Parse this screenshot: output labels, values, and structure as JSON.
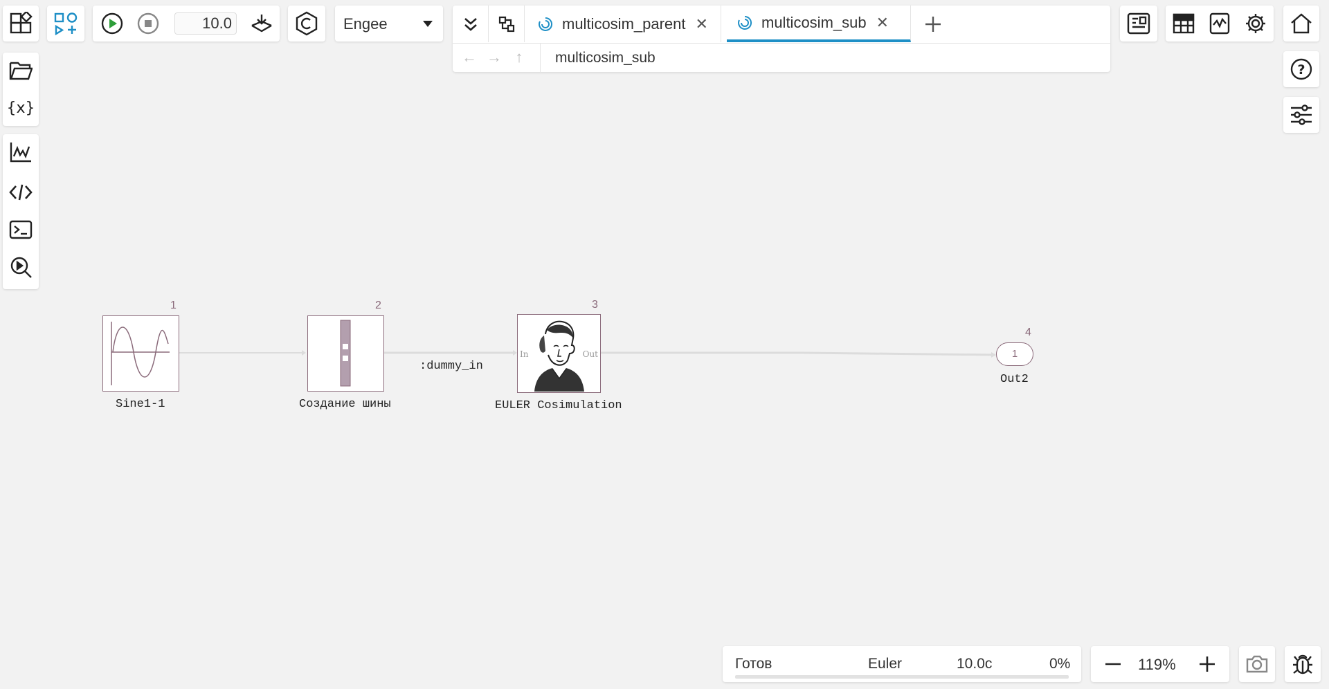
{
  "toolbar": {
    "sim_time": "10.0",
    "solver_select": "Engee"
  },
  "tabs": [
    {
      "label": "multicosim_parent",
      "active": false
    },
    {
      "label": "multicosim_sub",
      "active": true
    }
  ],
  "breadcrumb": {
    "path": "multicosim_sub"
  },
  "blocks": [
    {
      "number": "1",
      "label": "Sine1-1"
    },
    {
      "number": "2",
      "label": "Создание шины"
    },
    {
      "number": "3",
      "label": "EULER Cosimulation",
      "port_in": "In",
      "port_out": "Out"
    },
    {
      "number": "4",
      "label": "Out2",
      "port_value": "1"
    }
  ],
  "signal_label": ":dummy_in",
  "status": {
    "state": "Готов",
    "solver": "Euler",
    "time": "10.0c",
    "progress": "0%"
  },
  "zoom": {
    "level": "119%"
  }
}
